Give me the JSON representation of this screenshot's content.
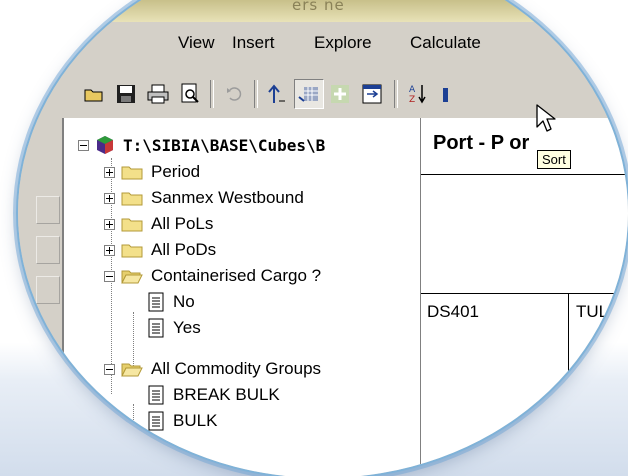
{
  "window": {
    "title_fragment": "ers ne"
  },
  "menu": {
    "items": [
      "View",
      "Insert",
      "Explore",
      "Calculate"
    ]
  },
  "toolbar": {
    "buttons": [
      "open-icon",
      "save-icon",
      "print-icon",
      "print-preview-icon",
      "undo-icon",
      "drill-up-icon",
      "pivot-icon",
      "expand-icon",
      "swap-icon",
      "sort-icon",
      "chart-icon"
    ],
    "tooltip": "Sort"
  },
  "tree": {
    "root": {
      "label": "T:\\SIBIA\\BASE\\Cubes\\B",
      "icon": "cube-icon"
    },
    "items": [
      {
        "label": "Period",
        "level": 1,
        "type": "folder",
        "state": "collapsed"
      },
      {
        "label": "Sanmex Westbound",
        "level": 1,
        "type": "folder",
        "state": "collapsed"
      },
      {
        "label": "All PoLs",
        "level": 1,
        "type": "folder",
        "state": "collapsed"
      },
      {
        "label": "All PoDs",
        "level": 1,
        "type": "folder",
        "state": "collapsed"
      },
      {
        "label": "Containerised Cargo ?",
        "level": 1,
        "type": "folder",
        "state": "expanded"
      },
      {
        "label": "No",
        "level": 2,
        "type": "document"
      },
      {
        "label": "Yes",
        "level": 2,
        "type": "document"
      },
      {
        "label": "All Commodity Groups",
        "level": 1,
        "type": "folder",
        "state": "expanded"
      },
      {
        "label": "BREAK BULK",
        "level": 2,
        "type": "document"
      },
      {
        "label": "BULK",
        "level": 2,
        "type": "document"
      }
    ]
  },
  "grid": {
    "title": "Port - P  or",
    "cells": [
      "DS401",
      "TUL"
    ]
  },
  "colors": {
    "face": "#d4d0c8",
    "tooltip_bg": "#ffffe1",
    "folder": "#f3e08a",
    "lens_border": "#7fb2d8"
  }
}
